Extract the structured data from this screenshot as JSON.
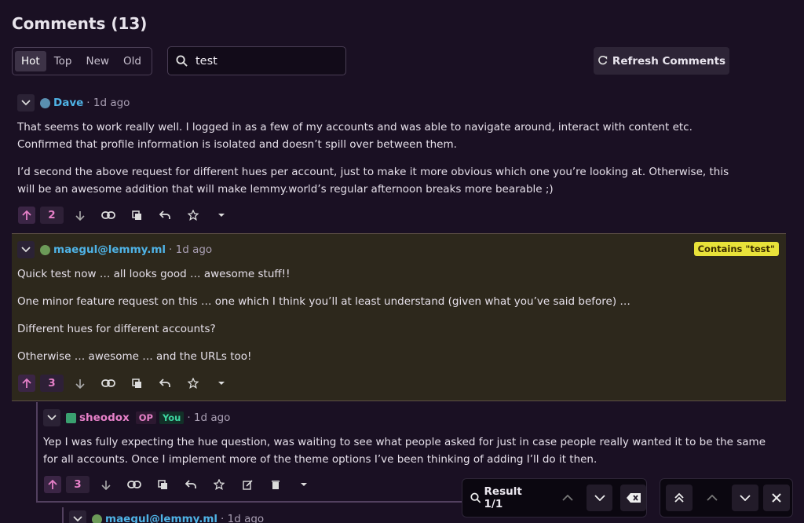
{
  "header": {
    "title": "Comments (13)"
  },
  "sort": {
    "options": [
      "Hot",
      "Top",
      "New",
      "Old"
    ],
    "active": "Hot"
  },
  "search": {
    "value": "test"
  },
  "refresh": {
    "label": "Refresh Comments"
  },
  "comments": [
    {
      "user": "Dave",
      "time": "· 1d ago",
      "score": "2",
      "paragraphs": [
        "That seems to work really well. I logged in as a few of my accounts and was able to navigate around, interact with content etc. Confirmed that profile information is isolated and doesn’t spill over between them.",
        "I’d second the above request for different hues per account, just to make it more obvious which one you’re looking at. Otherwise, this will be an awesome addition that will make lemmy.world’s regular afternoon breaks more bearable ;)"
      ]
    },
    {
      "user": "maegul@lemmy.ml",
      "time": "· 1d ago",
      "score": "3",
      "match_label": "Contains \"test\"",
      "paragraphs": [
        "Quick test now … all looks good … awesome stuff!!",
        "One minor feature request on this … one which I think you’ll at least understand (given what you’ve said before) …",
        "Different hues for different accounts?",
        "Otherwise … awesome … and the URLs too!"
      ]
    },
    {
      "user": "sheodox",
      "op_tag": "OP",
      "you_tag": "You",
      "time": "· 1d ago",
      "score": "3",
      "paragraphs": [
        "Yep I was fully expecting the hue question, was waiting to see what people asked for just in case people really wanted it to be the same for all accounts. Once I implement more of the theme options I’ve been thinking of adding I’ll do it then."
      ]
    },
    {
      "user": "maegul@lemmy.ml",
      "time": "· 1d ago"
    }
  ],
  "findbar": {
    "result": "Result 1/1"
  },
  "colors": {
    "accent": "#e680c8",
    "username": "#4fb3e6",
    "highlight_bg": "#2d281c",
    "match_badge": "#e8e23a"
  }
}
